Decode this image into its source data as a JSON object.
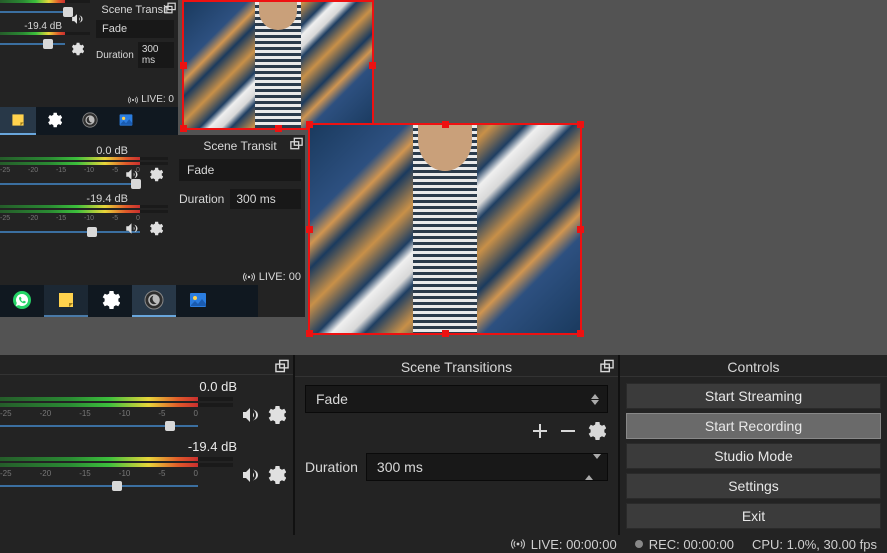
{
  "mixer": {
    "channels": [
      {
        "db": "0.0 dB",
        "thumb_pct": 82
      },
      {
        "db": "-19.4 dB",
        "thumb_pct": 58
      }
    ],
    "ticks": [
      "-25",
      "-20",
      "-15",
      "-10",
      "-5",
      "0"
    ]
  },
  "transitions": {
    "title": "Scene Transitions",
    "selected": "Fade",
    "duration_label": "Duration",
    "duration_value": "300 ms"
  },
  "controls": {
    "title": "Controls",
    "buttons": {
      "start_streaming": "Start Streaming",
      "start_recording": "Start Recording",
      "studio_mode": "Studio Mode",
      "settings": "Settings",
      "exit": "Exit"
    }
  },
  "status": {
    "live": "LIVE: 00:00:00",
    "rec": "REC: 00:00:00",
    "cpu": "CPU: 1.0%, 30.00 fps"
  },
  "mini_a": {
    "trans_title": "Scene Transit",
    "selected": "Fade",
    "duration_label": "Duration",
    "duration_value": "300 ms",
    "live_label": "LIVE: 0",
    "db1": "-19.4 dB"
  },
  "mini_b": {
    "trans_title": "Scene Transit",
    "selected": "Fade",
    "duration_label": "Duration",
    "duration_value": "300 ms",
    "live_label": "LIVE: 00",
    "db1": "0.0 dB",
    "db2": "-19.4 dB"
  }
}
